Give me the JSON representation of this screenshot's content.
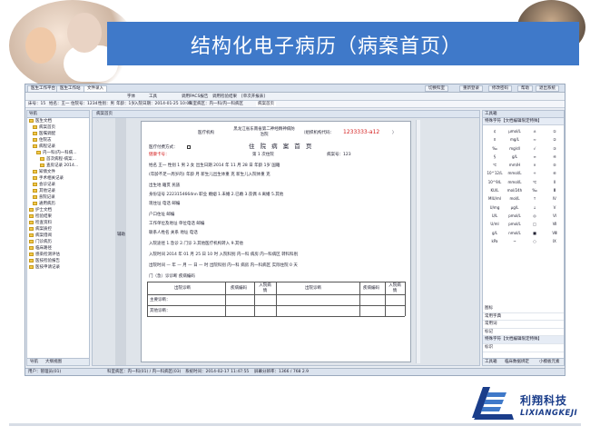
{
  "slide": {
    "title": "结构化电子病历（病案首页）"
  },
  "app": {
    "tabs": [
      "医生工作平台",
      "医生工作站",
      "文件录入"
    ],
    "right_buttons": [
      "切换科室",
      "重新登录",
      "修改密码",
      "帮助",
      "退出系统"
    ],
    "toolbar": [
      "字体",
      "工具",
      "调用PACS报告",
      "调用检验结果",
      "[单次开报表]"
    ],
    "infobar": [
      "床号：15",
      "姓名：王一",
      "住院号：1234",
      "性别：男",
      "年龄：1岁",
      "入院日期：2014-01-25 10:08",
      "科室病区：内一科/内一科病区",
      "病案首页"
    ],
    "left_panel": {
      "header": "导航",
      "items": [
        "医生文档",
        "病案首页",
        "医嘱调配",
        "住院志",
        "病程记录",
        "内一科(内一科病...",
        "首次病程-病案...",
        "查房记录 2014...",
        "知情文件",
        "手术相关记录",
        "会诊记录",
        "其他记录",
        "출院记录",
        "通用病历",
        "护士文档",
        "检验结果",
        "检查资料",
        "病案质控",
        "病案借阅",
        "门诊病历",
        "临床路径",
        "感染检测评估",
        "医技检验报告",
        "医技申请记录"
      ],
      "bottom_tabs": [
        "导航",
        "大纲视图"
      ]
    },
    "doc": {
      "tab_label": "病案首页",
      "side_label": "辅助",
      "org_label": "医疗机构",
      "hospital_name": "黑龙江省东南省第二神经精神病防治院",
      "org_code_label": "（组织机构代码：",
      "org_code": "1233333-a12",
      "org_code_close": "）",
      "payment_label": "医疗付费方式：",
      "health_card": "健康卡号：",
      "form_title": "住 院 病 案 首 页",
      "admit_count": "第 1 次住院",
      "case_no": "病案号：123",
      "row_name": "姓名  王一    性别  1 男 2.女  出生日期  2014 年 11 月 28 日  年龄  1岁    国籍",
      "row_age": "(年龄不足一周岁的) 年龄      月   新生儿出生体重      克   新生儿入院体重      克",
      "row_birth": "出生地                                籍贯                    民族",
      "row_id": "身份证号      2223154664nn     职业              婚姻  1.未婚 2.已婚 3.丧偶 4.离婚 5.其他",
      "row_addr": "现住址                                       电话              邮编",
      "row_hukou": "户口住址                                                          邮编",
      "row_work": "工作单位及地址                          单位电话             邮编",
      "row_contact": "联系人姓名          关系          地址                   电话",
      "row_route": "入院途径  1.急诊    2.门诊     3.其他医疗机构转入     9.其他",
      "row_admit": "入院时间   2014 年 01 月 25 日 10 时  入院科别  内一科  病房  内一科病区  转科科别",
      "row_disch": "出院时间  —  年  —  月  —  日  —  时  出院科别  内一科  病房  内一科病区  实际住院     0     天",
      "row_diag": "门（急）诊诊断                                    疾病编码",
      "table_headers": [
        "出院诊断",
        "疾病编码",
        "入院病情",
        "出院诊断",
        "疾病编码",
        "入院病情"
      ],
      "row_main": "主要诊断：",
      "row_other": "其他诊断："
    },
    "right_panel": {
      "header": "工具箱",
      "sym_title": "特殊字符【文档编辑限定特殊】",
      "symbols": [
        [
          "¢",
          "μmol/L",
          "±",
          "①"
        ],
        [
          "¤",
          "mg/L",
          "≈",
          "②"
        ],
        [
          "‰",
          "mg/dl",
          "√",
          "③"
        ],
        [
          "§",
          "g/L",
          "∞",
          "④"
        ],
        [
          "℃",
          "mm/H",
          "×",
          "⑤"
        ],
        [
          "10^12/L",
          "mmol/L",
          "÷",
          "⑥"
        ],
        [
          "10^9/L",
          "mmol/L",
          "℃",
          "Ⅱ"
        ],
        [
          "KU/L",
          "mol/24h",
          "‰",
          "Ⅲ"
        ],
        [
          "MIU/ml",
          "mol/L",
          "↑",
          "Ⅳ"
        ],
        [
          "U/mg",
          "μg/L",
          "↓",
          "Ⅴ"
        ],
        [
          "U/L",
          "pmol/L",
          "◎",
          "Ⅵ"
        ],
        [
          "U/ml",
          "pmol/L",
          "□",
          "Ⅶ"
        ],
        [
          "g/L",
          "nmol/L",
          "■",
          "Ⅷ"
        ],
        [
          "kPa",
          "~",
          "○",
          "Ⅸ"
        ]
      ],
      "list": [
        "图标",
        "常用字典",
        "常用词",
        "标记",
        "特殊字符【文档编辑限定特殊】",
        "标识"
      ],
      "bottom_tabs": [
        "工具箱",
        "临床数据绑定",
        "小模板元素"
      ]
    },
    "status": [
      "用户：管理员(01)",
      "科室病区：内一科(01) / 内一科病区(03)",
      "系统时间：2014-02-17 11:47:55",
      "屏幕分辨率：1366 / 768 2.9"
    ]
  },
  "logo": {
    "cn": "利翔科技",
    "en": "LIXIANGKEJI",
    "colors": {
      "primary": "#1a3d8a"
    }
  },
  "colors": {
    "banner": "#3f79c9",
    "org_code": "#d52020"
  }
}
